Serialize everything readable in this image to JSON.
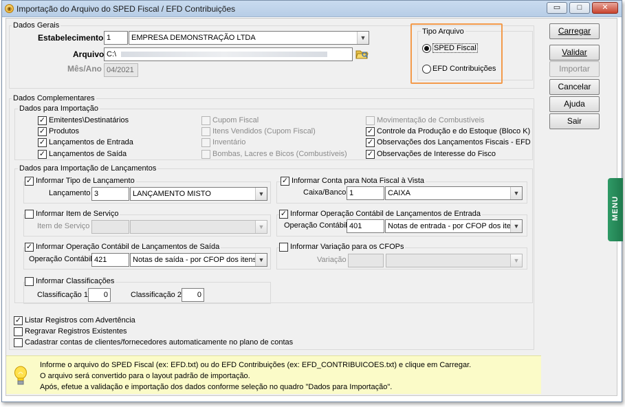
{
  "window": {
    "title": "Importação do Arquivo do SPED Fiscal / EFD Contribuições",
    "minimize": "▭",
    "restore": "□",
    "close": "✕"
  },
  "dados_gerais": {
    "legend": "Dados Gerais",
    "estabelecimento_label": "Estabelecimento",
    "estabelecimento_code": "1",
    "estabelecimento_name": "EMPRESA DEMONSTRAÇÃO LTDA",
    "arquivo_label": "Arquivo",
    "arquivo_value": "C:\\",
    "mes_ano_label": "Mês/Ano",
    "mes_ano_value": "04/2021"
  },
  "tipo_arquivo": {
    "legend": "Tipo Arquivo",
    "options": [
      {
        "label": "SPED Fiscal",
        "selected": true
      },
      {
        "label": "EFD Contribuições",
        "selected": false
      }
    ]
  },
  "buttons": {
    "carregar": "Carregar",
    "validar": "Validar",
    "importar": "Importar",
    "cancelar": "Cancelar",
    "ajuda": "Ajuda",
    "sair": "Sair"
  },
  "menu_tab": "MENU",
  "dados_complementares": {
    "legend": "Dados Complementares",
    "importacao_legend": "Dados para Importação",
    "col1": [
      {
        "label": "Emitentes\\Destinatários",
        "checked": true
      },
      {
        "label": "Produtos",
        "checked": true
      },
      {
        "label": "Lançamentos de Entrada",
        "checked": true
      },
      {
        "label": "Lançamentos de Saída",
        "checked": true
      }
    ],
    "col2": [
      {
        "label": "Cupom Fiscal",
        "checked": false
      },
      {
        "label": "Itens Vendidos (Cupom Fiscal)",
        "checked": false
      },
      {
        "label": "Inventário",
        "checked": false
      },
      {
        "label": "Bombas, Lacres e Bicos (Combustíveis)",
        "checked": false
      }
    ],
    "col3": [
      {
        "label": "Movimentação de Combustíveis",
        "checked": false
      },
      {
        "label": "Controle da Produção e do Estoque (Bloco K)",
        "checked": true
      },
      {
        "label": "Observações dos Lançamentos Fiscais - EFD",
        "checked": true
      },
      {
        "label": "Observações de Interesse do Fisco",
        "checked": true
      }
    ]
  },
  "lancamentos": {
    "legend": "Dados para Importação de Lançamentos",
    "tipo": {
      "title": "Informar Tipo de Lançamento",
      "checked": true,
      "label": "Lançamento",
      "code": "3",
      "value": "LANÇAMENTO MISTO"
    },
    "conta_vista": {
      "title": "Informar Conta para Nota Fiscal à Vista",
      "checked": true,
      "label": "Caixa/Banco",
      "code": "1",
      "value": "CAIXA"
    },
    "item_servico": {
      "title": "Informar Item de Serviço",
      "checked": false,
      "label": "Item de Serviço",
      "code": "",
      "value": ""
    },
    "op_entrada": {
      "title": "Informar Operação Contábil de Lançamentos de Entrada",
      "checked": true,
      "label": "Operação Contábil",
      "code": "401",
      "value": "Notas de entrada - por CFOP dos itens"
    },
    "op_saida": {
      "title": "Informar Operação Contábil de Lançamentos de Saída",
      "checked": true,
      "label": "Operação Contábil",
      "code": "421",
      "value": "Notas de saída - por CFOP dos itens"
    },
    "variacao": {
      "title": "Informar Variação para os CFOPs",
      "checked": false,
      "label": "Variação",
      "code": "",
      "value": ""
    },
    "classificacoes": {
      "title": "Informar Classificações",
      "checked": false,
      "label1": "Classificação 1",
      "value1": "0",
      "label2": "Classificação 2",
      "value2": "0"
    }
  },
  "options": [
    {
      "label": "Listar Registros com Advertência",
      "checked": true
    },
    {
      "label": "Regravar Registros Existentes",
      "checked": false
    },
    {
      "label": "Cadastrar contas de clientes/fornecedores automaticamente no plano de contas",
      "checked": false
    }
  ],
  "info": {
    "icon": "lightbulb-icon",
    "lines": [
      "Informe o arquivo do SPED Fiscal (ex: EFD.txt) ou do EFD Contribuições (ex: EFD_CONTRIBUICOES.txt) e clique em Carregar.",
      "O arquivo será convertido para o layout padrão de importação.",
      "Após, efetue a validação e importação dos dados conforme seleção no quadro \"Dados para Importação\"."
    ]
  },
  "colors": {
    "highlight": "#f39a4a",
    "info_background": "#fbfbc8",
    "menu_tab": "#2f9a66"
  }
}
